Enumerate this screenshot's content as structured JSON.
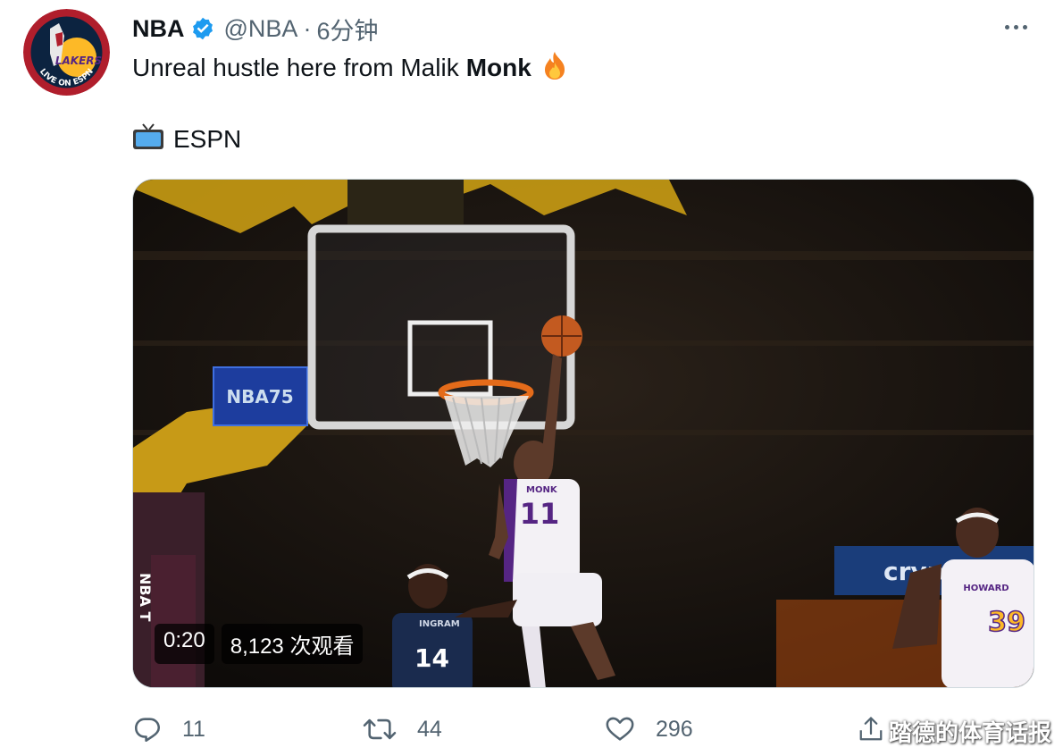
{
  "author": {
    "name": "NBA",
    "handle": "@NBA",
    "separator": "·",
    "time": "6分钟",
    "avatar_text": "LIVE ON ESPN",
    "avatar_logo_text": "LAKERS"
  },
  "tweet": {
    "text_prefix": "Unreal hustle here from Malik",
    "text_bold": "Monk",
    "fire_emoji": "🔥",
    "source_icon": "tv-icon",
    "source_label": "ESPN"
  },
  "video": {
    "duration": "0:20",
    "views": "8,123 次观看",
    "jersey_main_name": "MONK",
    "jersey_main_number": "11",
    "jersey_left_name": "INGRAM",
    "jersey_left_number": "14",
    "jersey_right_name": "HOWARD",
    "jersey_right_number": "39",
    "arena_sign_left": "NBA75",
    "arena_sign_right": "cryp",
    "stanchion_text": "NBA T"
  },
  "actions": {
    "reply_count": "11",
    "retweet_count": "44",
    "like_count": "296"
  },
  "watermark": "踏德的体育话报",
  "colors": {
    "verified_blue": "#1d9bf0",
    "muted": "#536471",
    "lakers_gold": "#fdb927",
    "lakers_purple": "#552583",
    "pelicans_navy": "#0c2340"
  }
}
